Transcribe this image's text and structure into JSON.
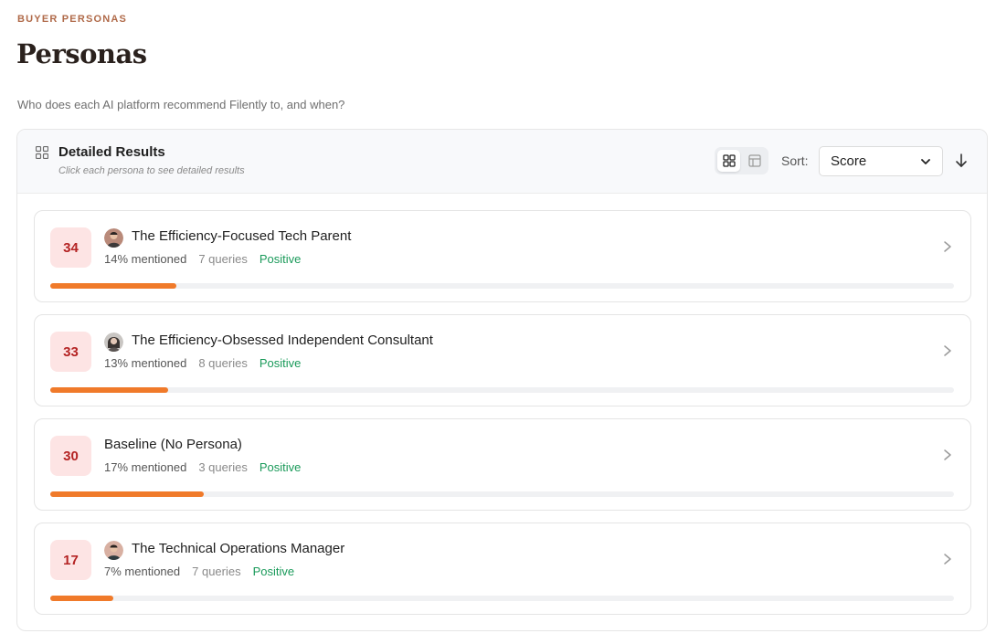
{
  "header": {
    "eyebrow": "BUYER PERSONAS",
    "title": "Personas",
    "subtitle": "Who does each AI platform recommend Filently to, and when?"
  },
  "panel": {
    "title": "Detailed Results",
    "hint": "Click each persona to see detailed results",
    "sort_label": "Sort:",
    "sort_value": "Score",
    "icons": {
      "panel": "grid-icon",
      "view_grid": "grid-view-icon",
      "view_table": "table-view-icon",
      "sort_direction": "arrow-down-icon"
    }
  },
  "personas": [
    {
      "score": "34",
      "name": "The Efficiency-Focused Tech Parent",
      "mentioned": "14% mentioned",
      "queries": "7 queries",
      "sentiment": "Positive",
      "has_avatar": true,
      "progress": 0.14
    },
    {
      "score": "33",
      "name": "The Efficiency-Obsessed Independent Consultant",
      "mentioned": "13% mentioned",
      "queries": "8 queries",
      "sentiment": "Positive",
      "has_avatar": true,
      "progress": 0.13
    },
    {
      "score": "30",
      "name": "Baseline (No Persona)",
      "mentioned": "17% mentioned",
      "queries": "3 queries",
      "sentiment": "Positive",
      "has_avatar": false,
      "progress": 0.17
    },
    {
      "score": "17",
      "name": "The Technical Operations Manager",
      "mentioned": "7% mentioned",
      "queries": "7 queries",
      "sentiment": "Positive",
      "has_avatar": true,
      "progress": 0.07
    }
  ],
  "colors": {
    "accent": "#f07a2a",
    "badge_bg": "#fde4e4",
    "badge_text": "#b42323",
    "positive": "#1a9a5a",
    "eyebrow": "#b06a49"
  }
}
